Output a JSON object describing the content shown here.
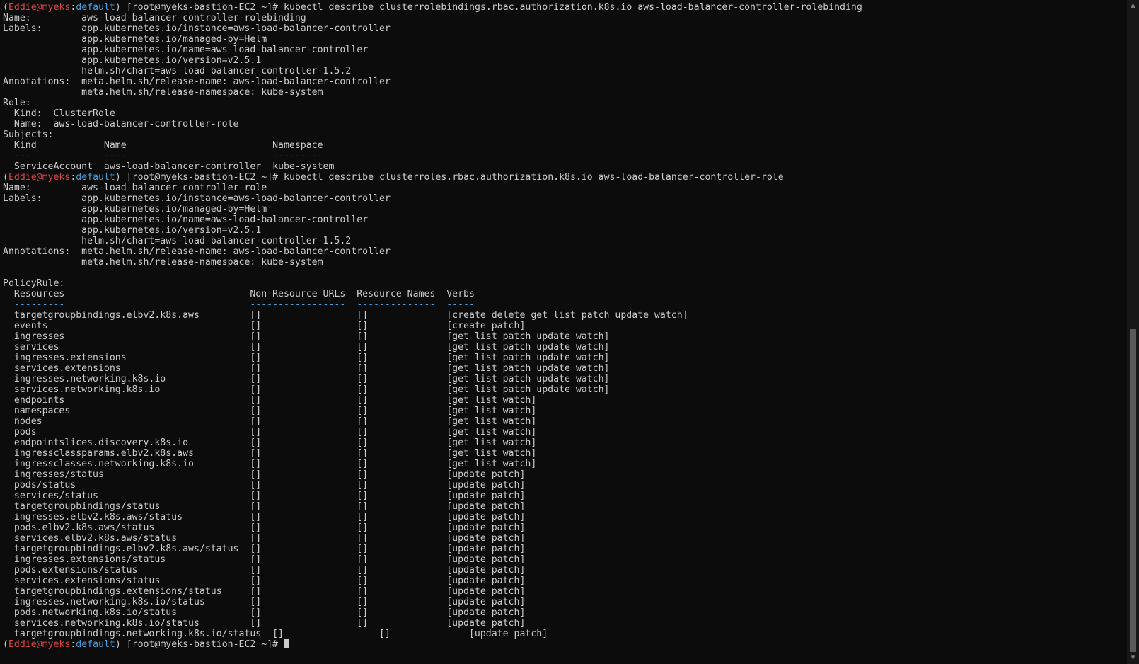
{
  "prompt": {
    "open": "(",
    "user": "Eddie",
    "at": "@",
    "host": "myeks",
    "colon": ":",
    "context": "default",
    "rest": ") [root@myeks-bastion-EC2 ~]# "
  },
  "command1": "kubectl describe clusterrolebindings.rbac.authorization.k8s.io aws-load-balancer-controller-rolebinding",
  "binding_lines": [
    "Name:         aws-load-balancer-controller-rolebinding",
    "Labels:       app.kubernetes.io/instance=aws-load-balancer-controller",
    "              app.kubernetes.io/managed-by=Helm",
    "              app.kubernetes.io/name=aws-load-balancer-controller",
    "              app.kubernetes.io/version=v2.5.1",
    "              helm.sh/chart=aws-load-balancer-controller-1.5.2",
    "Annotations:  meta.helm.sh/release-name: aws-load-balancer-controller",
    "              meta.helm.sh/release-namespace: kube-system",
    "Role:",
    "  Kind:  ClusterRole",
    "  Name:  aws-load-balancer-controller-role",
    "Subjects:",
    "  Kind            Name                          Namespace"
  ],
  "subjects_dashes": "  ----            ----                          ---------",
  "subjects_row": "  ServiceAccount  aws-load-balancer-controller  kube-system",
  "command2": "kubectl describe clusterroles.rbac.authorization.k8s.io aws-load-balancer-controller-role",
  "role_lines": [
    "Name:         aws-load-balancer-controller-role",
    "Labels:       app.kubernetes.io/instance=aws-load-balancer-controller",
    "              app.kubernetes.io/managed-by=Helm",
    "              app.kubernetes.io/name=aws-load-balancer-controller",
    "              app.kubernetes.io/version=v2.5.1",
    "              helm.sh/chart=aws-load-balancer-controller-1.5.2",
    "Annotations:  meta.helm.sh/release-name: aws-load-balancer-controller",
    "              meta.helm.sh/release-namespace: kube-system",
    "",
    "PolicyRule:",
    "  Resources                                 Non-Resource URLs  Resource Names  Verbs"
  ],
  "policy_dashes": "  ---------                                 -----------------  --------------  -----",
  "policy_rows": [
    "  targetgroupbindings.elbv2.k8s.aws         []                 []              [create delete get list patch update watch]",
    "  events                                    []                 []              [create patch]",
    "  ingresses                                 []                 []              [get list patch update watch]",
    "  services                                  []                 []              [get list patch update watch]",
    "  ingresses.extensions                      []                 []              [get list patch update watch]",
    "  services.extensions                       []                 []              [get list patch update watch]",
    "  ingresses.networking.k8s.io               []                 []              [get list patch update watch]",
    "  services.networking.k8s.io                []                 []              [get list patch update watch]",
    "  endpoints                                 []                 []              [get list watch]",
    "  namespaces                                []                 []              [get list watch]",
    "  nodes                                     []                 []              [get list watch]",
    "  pods                                      []                 []              [get list watch]",
    "  endpointslices.discovery.k8s.io           []                 []              [get list watch]",
    "  ingressclassparams.elbv2.k8s.aws          []                 []              [get list watch]",
    "  ingressclasses.networking.k8s.io          []                 []              [get list watch]",
    "  ingresses/status                          []                 []              [update patch]",
    "  pods/status                               []                 []              [update patch]",
    "  services/status                           []                 []              [update patch]",
    "  targetgroupbindings/status                []                 []              [update patch]",
    "  ingresses.elbv2.k8s.aws/status            []                 []              [update patch]",
    "  pods.elbv2.k8s.aws/status                 []                 []              [update patch]",
    "  services.elbv2.k8s.aws/status             []                 []              [update patch]",
    "  targetgroupbindings.elbv2.k8s.aws/status  []                 []              [update patch]",
    "  ingresses.extensions/status               []                 []              [update patch]",
    "  pods.extensions/status                    []                 []              [update patch]",
    "  services.extensions/status                []                 []              [update patch]",
    "  targetgroupbindings.extensions/status     []                 []              [update patch]",
    "  ingresses.networking.k8s.io/status        []                 []              [update patch]",
    "  pods.networking.k8s.io/status             []                 []              [update patch]",
    "  services.networking.k8s.io/status         []                 []              [update patch]",
    "  targetgroupbindings.networking.k8s.io/status  []                 []              [update patch]"
  ],
  "scrollbar": {
    "up_icon": "▲",
    "down_icon": "▼",
    "scroll_fraction": 1.0
  },
  "colors": {
    "background": "#0c0c0c",
    "text": "#cccccc",
    "user_host": "#e04848",
    "context": "#4aa0e0"
  }
}
